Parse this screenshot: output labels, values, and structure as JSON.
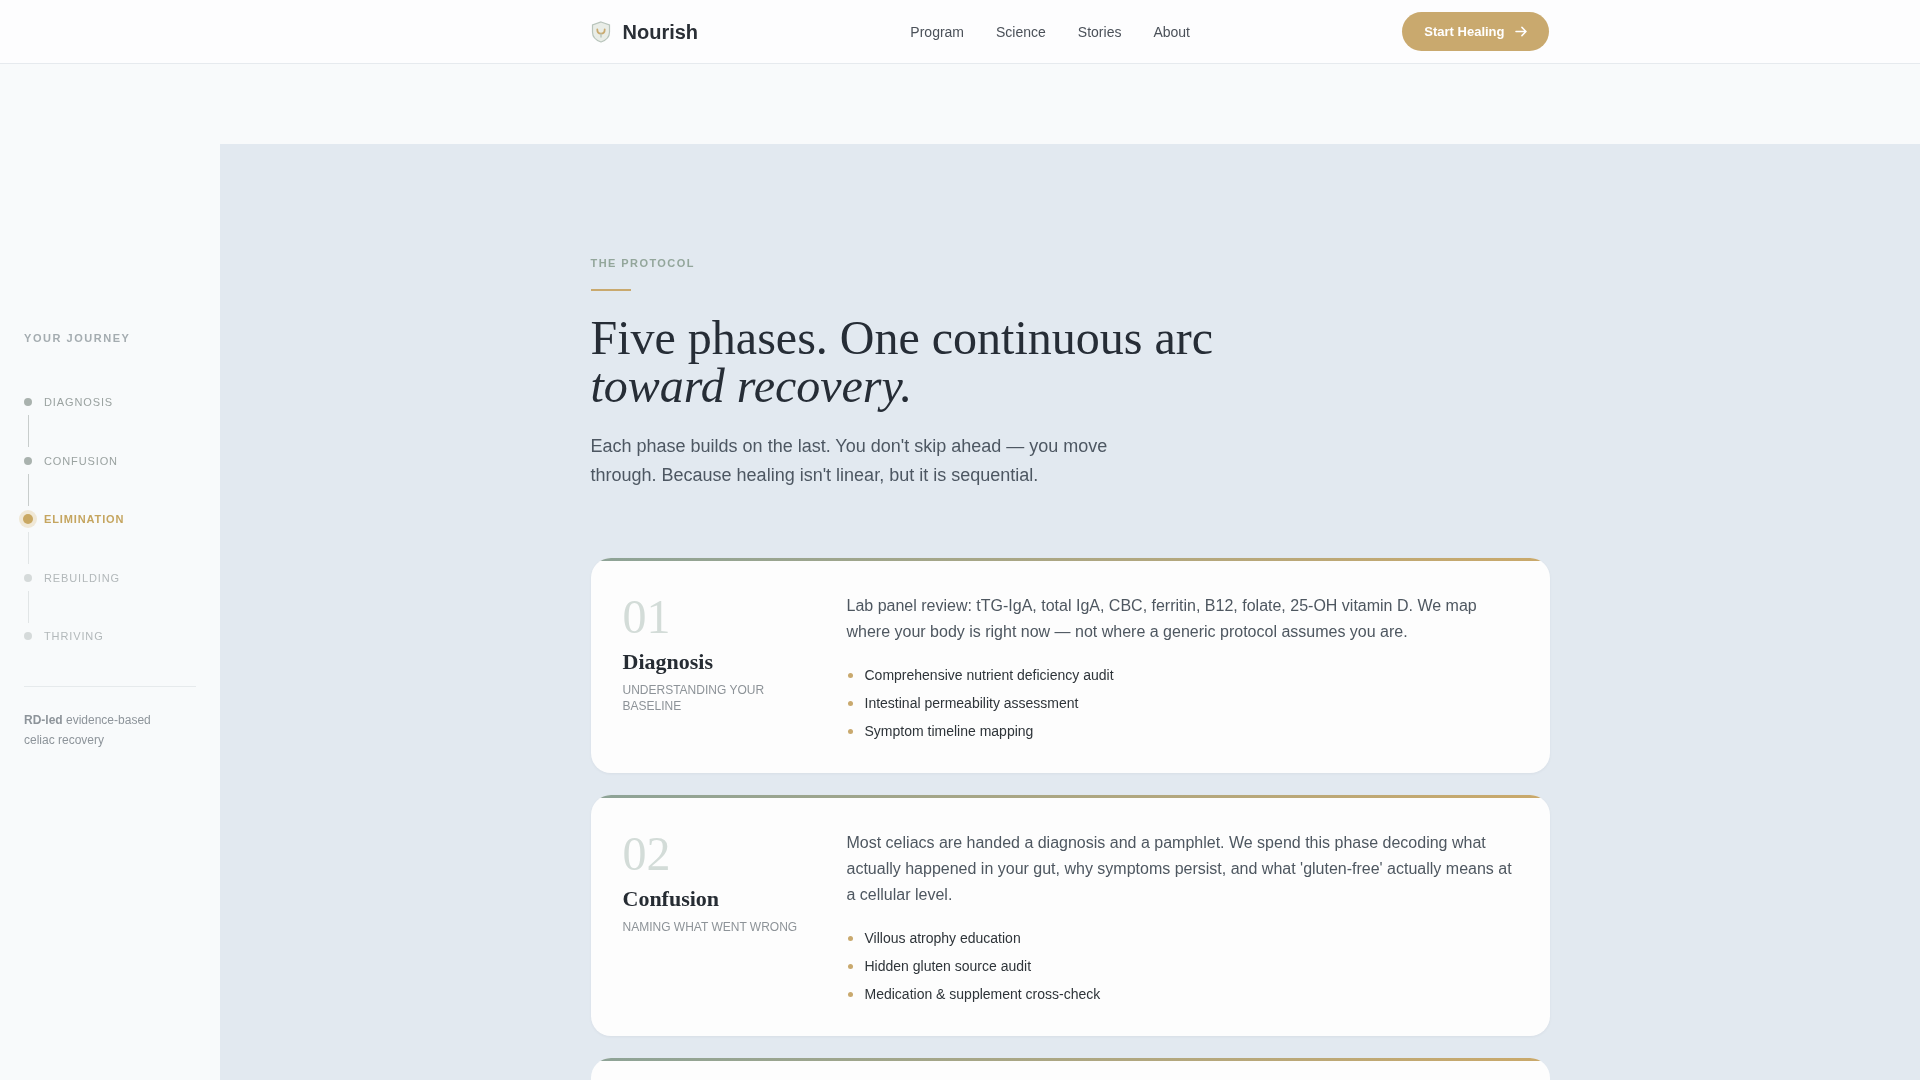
{
  "header": {
    "brand": "Nourish",
    "nav": [
      "Program",
      "Science",
      "Stories",
      "About"
    ],
    "cta": "Start Healing"
  },
  "sidebar": {
    "title": "YOUR JOURNEY",
    "steps": [
      {
        "label": "DIAGNOSIS",
        "completed": true,
        "selected": false
      },
      {
        "label": "CONFUSION",
        "completed": true,
        "selected": false
      },
      {
        "label": "ELIMINATION",
        "completed": false,
        "selected": true
      },
      {
        "label": "REBUILDING",
        "completed": false,
        "selected": false
      },
      {
        "label": "THRIVING",
        "completed": false,
        "selected": false
      }
    ],
    "note": "**RD-led** evidence-based celiac recovery"
  },
  "protocol": {
    "eyebrow": "THE PROTOCOL",
    "heading": "Five phases. One continuous arc *toward recovery.*",
    "intro": "Each phase builds on the last. You don't skip ahead — you move through. Because healing isn't linear, but it is sequential.",
    "phases": [
      {
        "number": "01",
        "title": "Diagnosis",
        "subtitle": "UNDERSTANDING YOUR BASELINE",
        "description": "Lab panel review: tTG-IgA, total IgA, CBC, ferritin, B12, folate, 25-OH vitamin D. We map where your body is right now — not where a generic protocol assumes you are.",
        "points": [
          "Comprehensive nutrient deficiency audit",
          "Intestinal permeability assessment",
          "Symptom timeline mapping"
        ]
      },
      {
        "number": "02",
        "title": "Confusion",
        "subtitle": "NAMING WHAT WENT WRONG",
        "description": "Most celiacs are handed a diagnosis and a pamphlet. We spend this phase decoding what actually happened in your gut, why symptoms persist, and what 'gluten-free' actually means at a cellular level.",
        "points": [
          "Villous atrophy education",
          "Hidden gluten source audit",
          "Medication & supplement cross-check"
        ]
      }
    ],
    "next_card_peek": true
  }
}
